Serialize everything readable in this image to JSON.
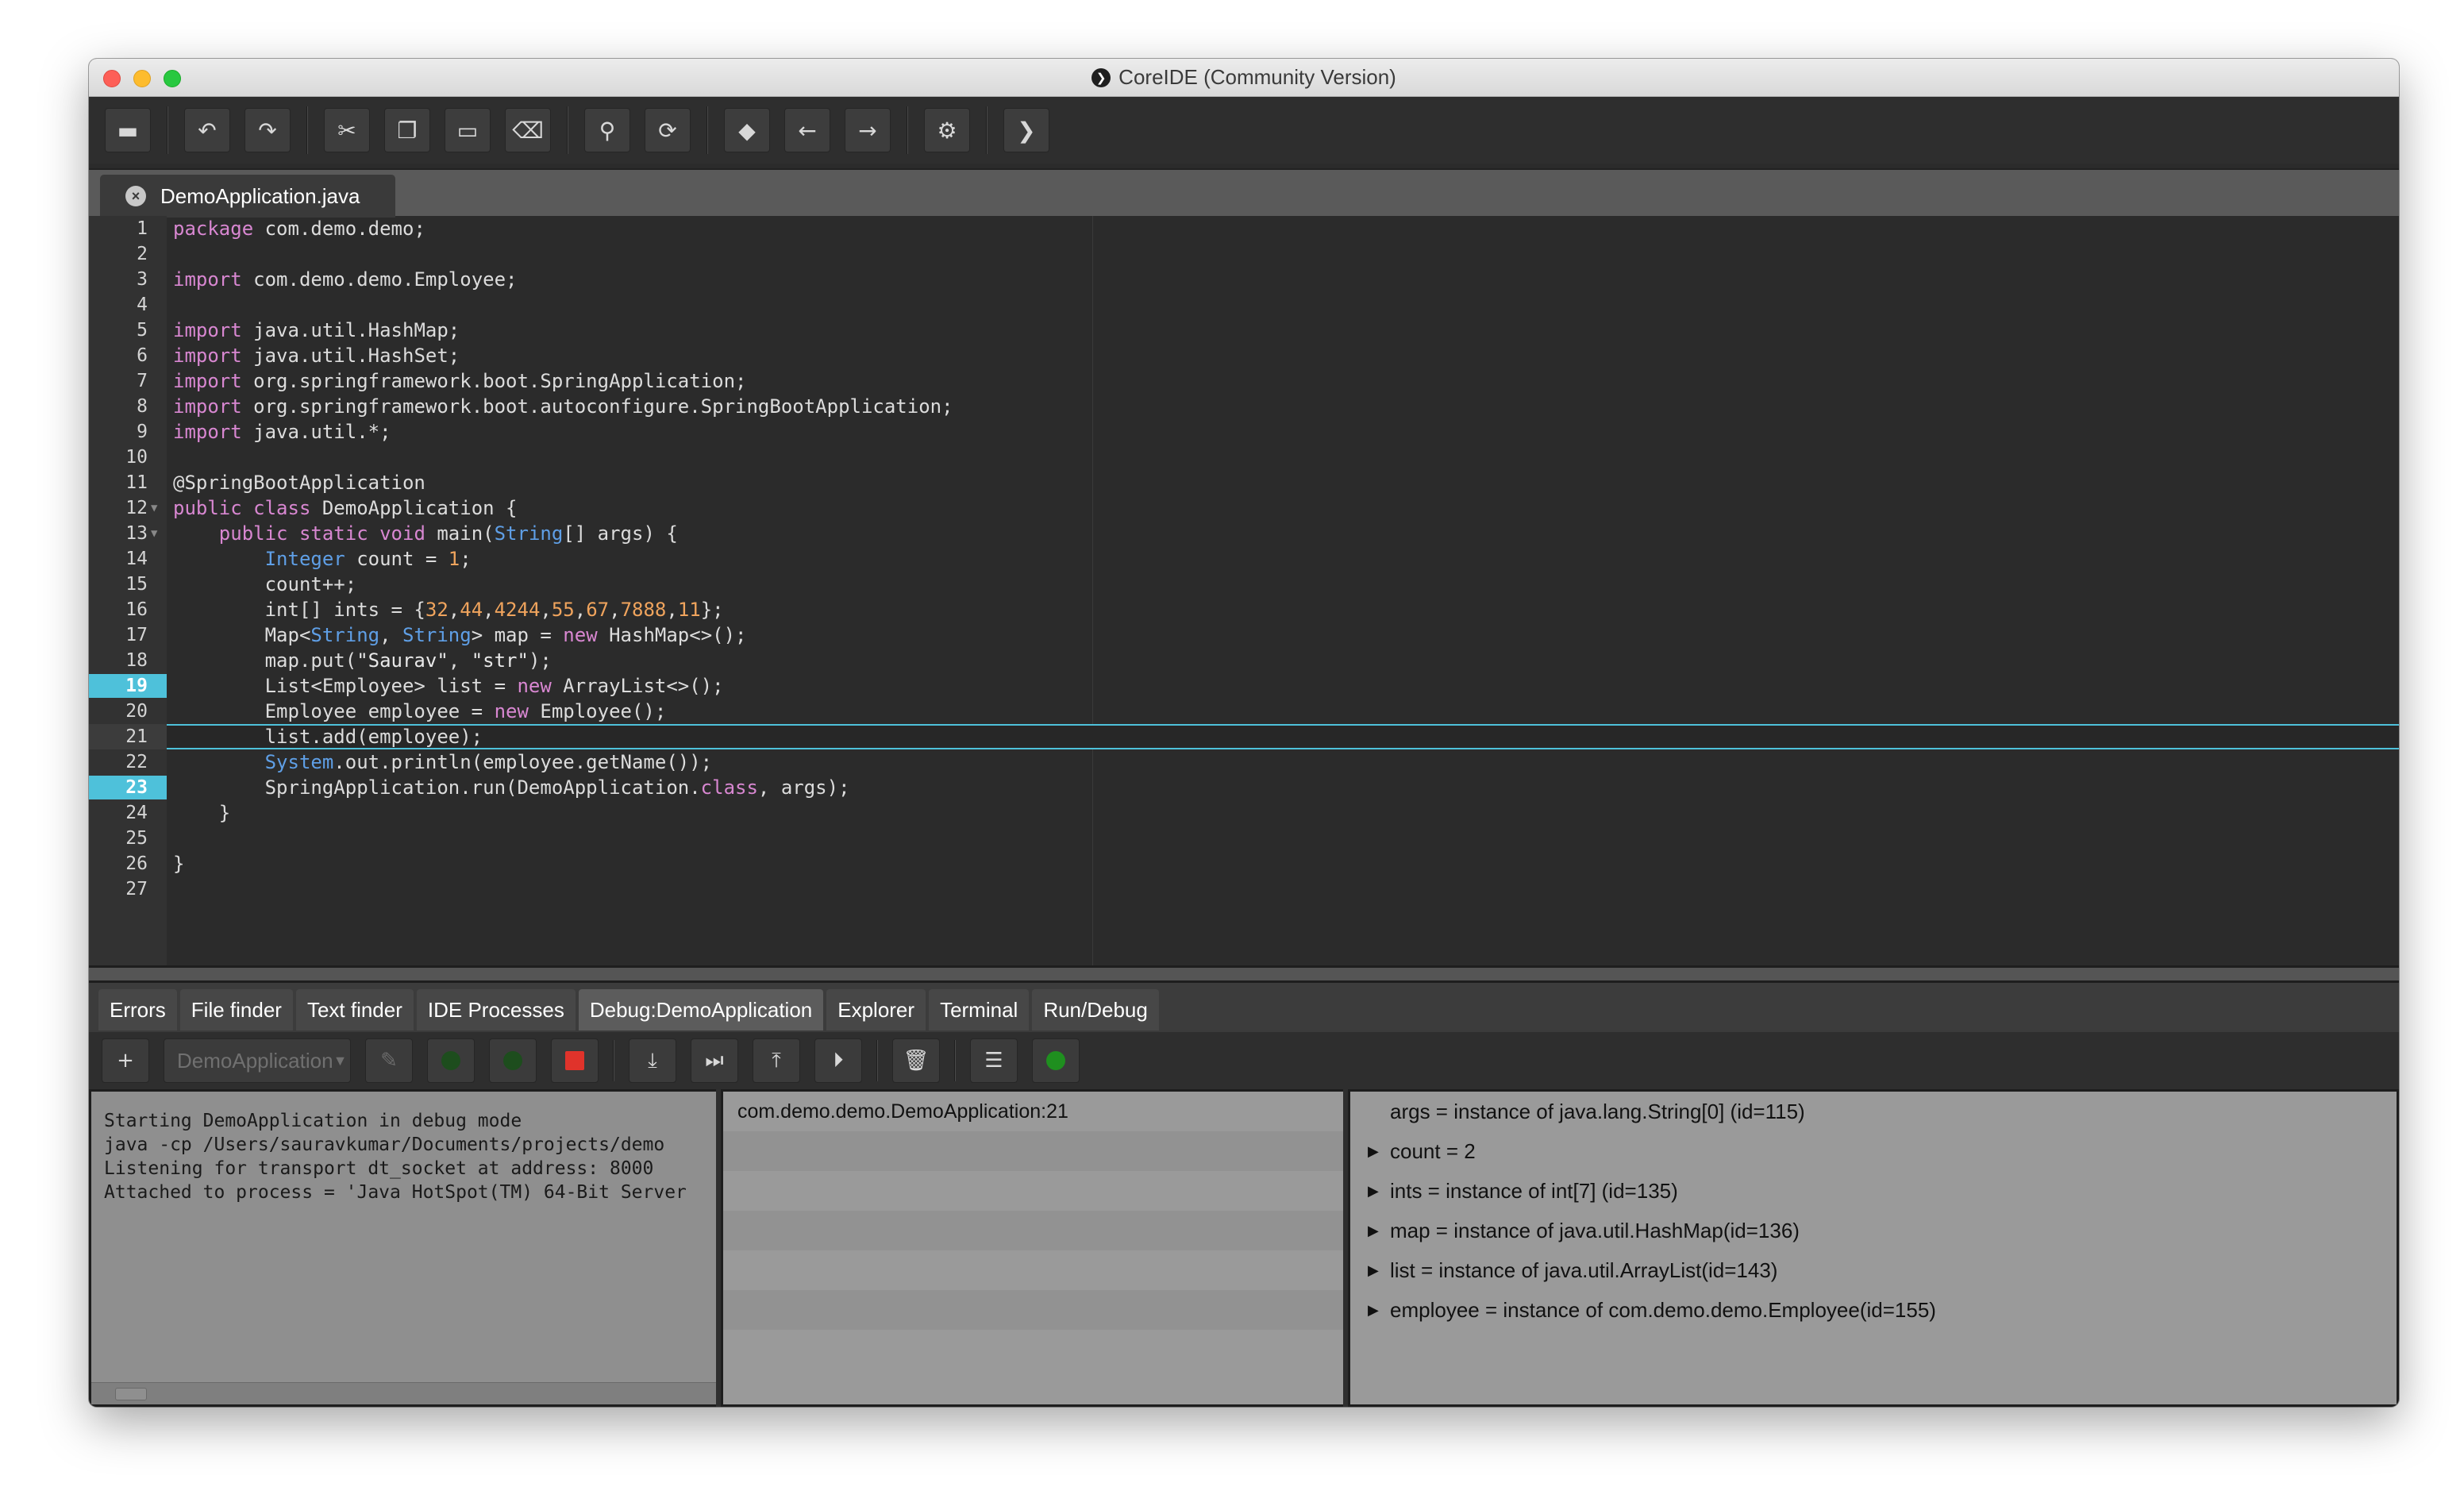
{
  "window": {
    "title": "CoreIDE (Community Version)"
  },
  "toolbar": {
    "buttons": [
      {
        "name": "open-folder",
        "glyph": "▬"
      },
      {
        "name": "undo",
        "glyph": "↶"
      },
      {
        "name": "redo",
        "glyph": "↷"
      },
      {
        "name": "cut",
        "glyph": "✂"
      },
      {
        "name": "copy",
        "glyph": "❐"
      },
      {
        "name": "paste",
        "glyph": "▭"
      },
      {
        "name": "delete",
        "glyph": "⌫"
      },
      {
        "name": "search",
        "glyph": "⚲"
      },
      {
        "name": "replace",
        "glyph": "⟳"
      },
      {
        "name": "bookmark",
        "glyph": "◆"
      },
      {
        "name": "back",
        "glyph": "←"
      },
      {
        "name": "forward",
        "glyph": "→"
      },
      {
        "name": "settings",
        "glyph": "⚙"
      },
      {
        "name": "run",
        "glyph": "❯"
      }
    ]
  },
  "editor": {
    "tab_label": "DemoApplication.java",
    "breakpoints": [
      19,
      23
    ],
    "current_line": 21,
    "lines": [
      "package com.demo.demo;",
      "",
      "import com.demo.demo.Employee;",
      "",
      "import java.util.HashMap;",
      "import java.util.HashSet;",
      "import org.springframework.boot.SpringApplication;",
      "import org.springframework.boot.autoconfigure.SpringBootApplication;",
      "import java.util.*;",
      "",
      "@SpringBootApplication",
      "public class DemoApplication {",
      "    public static void main(String[] args) {",
      "        Integer count = 1;",
      "        count++;",
      "        int[] ints = {32,44,4244,55,67,7888,11};",
      "        Map<String, String> map = new HashMap<>();",
      "        map.put(\"Saurav\", \"str\");",
      "        List<Employee> list = new ArrayList<>();",
      "        Employee employee = new Employee();",
      "        list.add(employee);",
      "        System.out.println(employee.getName());",
      "        SpringApplication.run(DemoApplication.class, args);",
      "    }",
      "",
      "}",
      ""
    ]
  },
  "bottom_tabs": [
    "Errors",
    "File finder",
    "Text finder",
    "IDE Processes",
    "Debug:DemoApplication",
    "Explorer",
    "Terminal",
    "Run/Debug"
  ],
  "active_bottom_tab": "Debug:DemoApplication",
  "debug": {
    "config_select": "DemoApplication",
    "console_lines": [
      "Starting DemoApplication in debug mode",
      "java -cp /Users/sauravkumar/Documents/projects/demo",
      "Listening for transport dt_socket at address: 8000",
      "Attached to process = 'Java HotSpot(TM) 64-Bit Server"
    ],
    "frames": [
      "com.demo.demo.DemoApplication:21",
      "",
      "",
      "",
      "",
      "",
      ""
    ],
    "variables": [
      {
        "text": "args = instance of java.lang.String[0] (id=115)",
        "expandable": false
      },
      {
        "text": "count = 2",
        "expandable": true
      },
      {
        "text": "ints = instance of int[7] (id=135)",
        "expandable": true
      },
      {
        "text": "map = instance of java.util.HashMap(id=136)",
        "expandable": true
      },
      {
        "text": "list = instance of java.util.ArrayList(id=143)",
        "expandable": true
      },
      {
        "text": "employee = instance of com.demo.demo.Employee(id=155)",
        "expandable": true
      }
    ]
  },
  "colors": {
    "keyword": "#d887d1",
    "type": "#5f9fe6",
    "number": "#f0a45d",
    "breakpoint": "#4ec1da",
    "stop": "#e0332b",
    "run_green": "#1f8f1f"
  }
}
